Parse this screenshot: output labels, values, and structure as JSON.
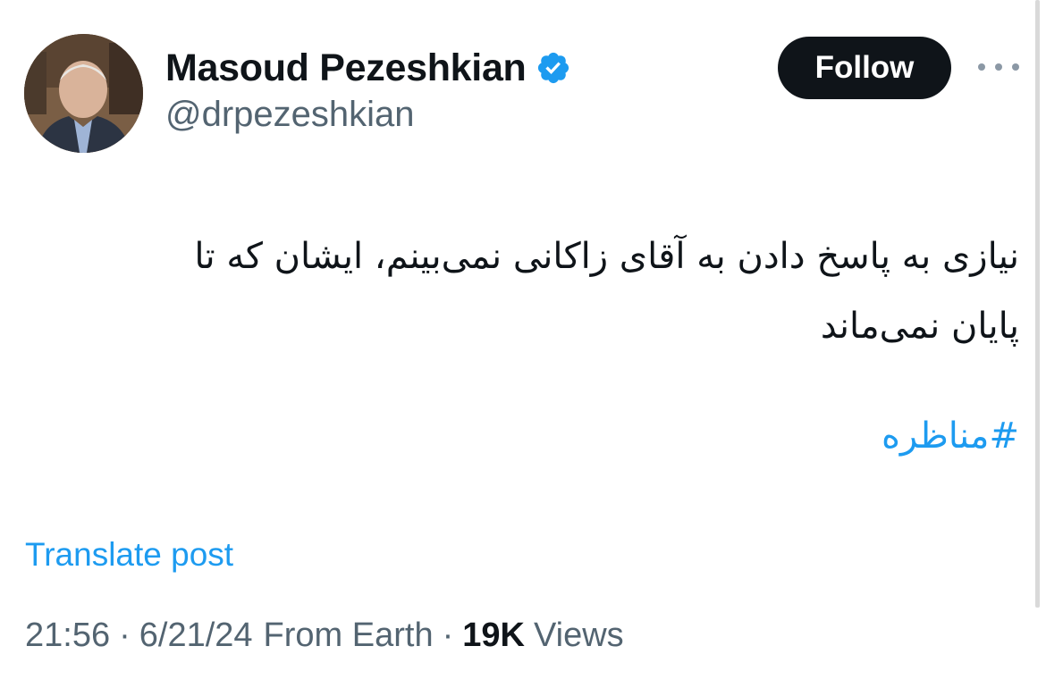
{
  "author": {
    "display_name": "Masoud Pezeshkian",
    "handle": "@drpezeshkian",
    "verified": true
  },
  "actions": {
    "follow_label": "Follow",
    "more_icon": "more-horizontal-icon"
  },
  "post": {
    "line1": "نیازی به پاسخ دادن به آقای زاکانی نمی‌بینم، ایشان که تا",
    "line2": "پایان نمی‌ماند",
    "hashtag": "#مناظره"
  },
  "translate_label": "Translate post",
  "meta": {
    "time": "21:56",
    "date": "6/21/24",
    "location": "From Earth",
    "separator": "·",
    "views_count": "19K",
    "views_label": "Views"
  },
  "colors": {
    "accent": "#1d9bf0",
    "text_primary": "#0f1419",
    "text_secondary": "#536471",
    "follow_bg": "#0f1419"
  }
}
